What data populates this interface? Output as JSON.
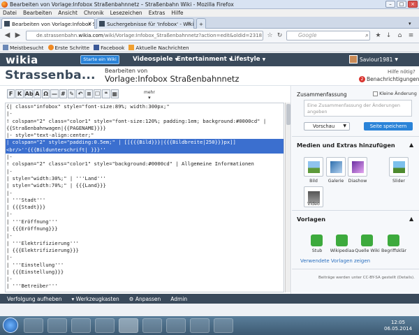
{
  "window": {
    "title": "Bearbeiten von Vorlage:Infobox Straßenbahnnetz – Straßenbahn Wiki - Mozilla Firefox"
  },
  "menu": [
    {
      "label": "Datei"
    },
    {
      "label": "Bearbeiten"
    },
    {
      "label": "Ansicht"
    },
    {
      "label": "Chronik"
    },
    {
      "label": "Lesezeichen"
    },
    {
      "label": "Extras"
    },
    {
      "label": "Hilfe"
    }
  ],
  "tabs": [
    {
      "label": "Bearbeiten von Vorlage:Infobox Straß..."
    },
    {
      "label": "Suchergebnisse für 'Infobox' - Wikia ..."
    }
  ],
  "nav": {
    "url_prefix": "de.strassenbahn.",
    "url_domain": "wikia.com",
    "url_rest": "/wiki/Vorlage:Infobox_Straßenbahnnetz?action=edit&oldid=2318",
    "search_placeholder": "Google"
  },
  "bookmarks": [
    {
      "label": "Meistbesucht"
    },
    {
      "label": "Erste Schritte"
    },
    {
      "label": "Facebook"
    },
    {
      "label": "Aktuelle Nachrichten"
    }
  ],
  "wikia": {
    "logo": "wikia",
    "start_button": "Starte ein Wiki",
    "nav_items": [
      "Videospiele",
      "Entertainment",
      "Lifestyle"
    ],
    "username": "Saviour1981"
  },
  "page": {
    "wiki_name": "Strassenba...",
    "edit_label": "Bearbeiten von",
    "title": "Vorlage:Infobox Straßenbahnnetz",
    "help": "Hilfe nötig?",
    "notifications": "Benachrichtigungen",
    "notifications_count": "2"
  },
  "editor": {
    "toolbar": [
      "F",
      "K",
      "Ab",
      "A",
      "Ω",
      "—",
      "#",
      "✎",
      "↶",
      "≡",
      "☐",
      "❝",
      "▦"
    ],
    "mehr": "mehr",
    "lines": [
      "{| class=\"infobox\" style=\"font-size:89%; width:300px;\"",
      "|-",
      "! colspan=\"2\" class=\"color1\" style=\"font-size:120%; padding:1em; background:#0000cd\" |",
      "{{Straßenbahnwagen|{{PAGENAME}}}}",
      "|- style=\"text-align:center;\"",
      "| colspan=\"2\" style=\"padding:0.5em;\" | [[{{{Bild}}}|{{{Bildbreite|250}}}px]]",
      "<br/>''{{{Bildunterschrift| }}}''",
      "|-",
      "! colspan=\"2\" class=\"color1\" style=\"background:#0000cd\" | Allgemeine Informationen",
      "|-",
      "| style=\"width:30%;\" | '''Land'''",
      "| style=\"width:70%;\" | {{{Land}}}",
      "|-",
      "| '''Stadt'''",
      "| {{{Stadt}}}",
      "|-",
      "| '''Eröffnung'''",
      "| {{{Eröffnung}}}",
      "|-",
      "| '''Elektrifizierung'''",
      "| {{{Elektrifizierung}}}",
      "|-",
      "| '''Einstellung'''",
      "| {{{Einstellung}}}",
      "|-",
      "| '''Betreiber'''"
    ],
    "selected_lines": [
      5,
      6
    ]
  },
  "sidebar": {
    "summary_title": "Zusammenfassung",
    "minor_edit": "Kleine Änderung",
    "summary_placeholder": "Eine Zusammenfassung der Änderungen angeben",
    "preview": "Vorschau",
    "save": "Seite speichern",
    "media_title": "Medien und Extras hinzufügen",
    "media": [
      "Bild",
      "Galerie",
      "Diashow",
      "Slider",
      "Video"
    ],
    "templates_title": "Vorlagen",
    "templates": [
      "Stub",
      "Wikipediaa",
      "Quelle Wiki",
      "Begriffsklär"
    ],
    "used_templates": "Verwendete Vorlagen zeigen",
    "license": "Beiträge werden unter CC-BY-SA gestellt (Details)."
  },
  "bottombar": [
    "Verfolgung aufheben",
    "Werkzeugkasten",
    "Anpassen",
    "Admin"
  ],
  "clock": {
    "time": "12:05",
    "date": "06.05.2014"
  },
  "colors": {
    "wikia_bar": "#3a4a5b",
    "accent_blue": "#2a83d8",
    "selection": "#3b6fcf"
  }
}
